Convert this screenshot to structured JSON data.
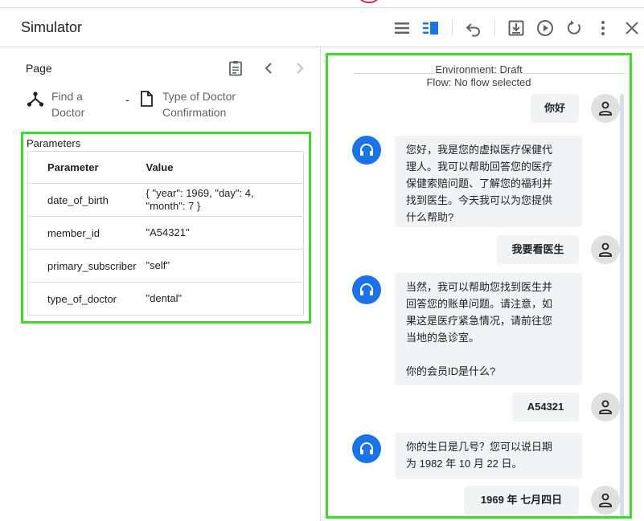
{
  "header": {
    "title": "Simulator"
  },
  "left": {
    "page_label": "Page",
    "crumb_from": {
      "line1": "Find a",
      "line2": "Doctor"
    },
    "crumb_sep": "-",
    "crumb_to": {
      "line1": "Type of Doctor",
      "line2": "Confirmation"
    }
  },
  "parameters": {
    "title": "Parameters",
    "columns": [
      "Parameter",
      "Value"
    ],
    "rows": [
      {
        "name": "date_of_birth",
        "value_line1": "{ \"year\": 1969, \"day\": 4,",
        "value_line2": "\"month\": 7 }"
      },
      {
        "name": "member_id",
        "value_line1": "\"A54321\"",
        "value_line2": ""
      },
      {
        "name": "primary_subscriber",
        "value_line1": "\"self\"",
        "value_line2": ""
      },
      {
        "name": "type_of_doctor",
        "value_line1": "\"dental\"",
        "value_line2": ""
      }
    ]
  },
  "chat": {
    "environment": "Environment: Draft",
    "flow": "Flow: No flow selected",
    "messages": [
      {
        "role": "user",
        "lines": [
          "你好"
        ]
      },
      {
        "role": "bot",
        "lines": [
          "您好，我是您的虚拟医疗保健代",
          "理人。我可以帮助回答您的医疗",
          "保健索赔问题、了解您的福利并",
          "找到医生。今天我可以为您提供",
          "什么帮助?"
        ]
      },
      {
        "role": "user",
        "lines": [
          "我要看医生"
        ]
      },
      {
        "role": "bot",
        "lines": [
          "当然，我可以帮助您找到医生并",
          "回答您的账单问题。请注意，如",
          "果这是医疗紧急情况，请前往您",
          "当地的急诊室。",
          "",
          "你的会员ID是什么?"
        ]
      },
      {
        "role": "user",
        "lines": [
          "A54321"
        ]
      },
      {
        "role": "bot",
        "lines": [
          "你的生日是几号？您可以说日期",
          "为 1982 年 10 月 22 日。"
        ]
      },
      {
        "role": "user",
        "lines": [
          "1969 年 七月四日"
        ]
      }
    ]
  },
  "colors": {
    "highlight": "#3ddc2b",
    "bot_avatar": "#1a73e8",
    "active_icon": "#1a73e8"
  }
}
